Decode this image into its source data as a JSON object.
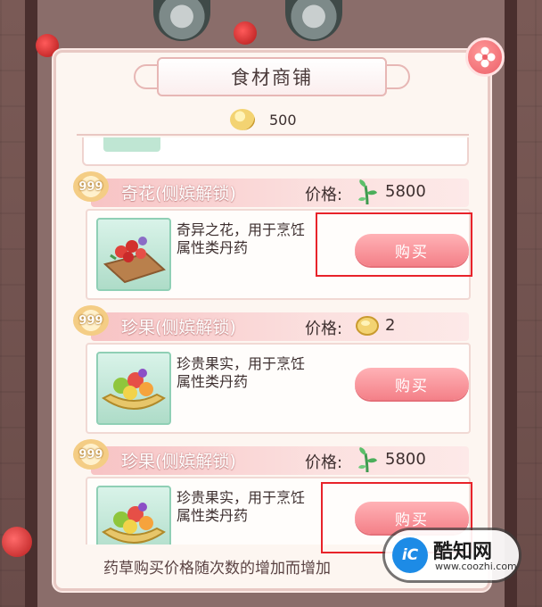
{
  "shop": {
    "title": "食材商铺",
    "coins": "500"
  },
  "items": [
    {
      "badge": "999",
      "name": "奇花(侧嫔解锁)",
      "price_label": "价格:",
      "price_icon": "herb-sprout-icon",
      "price": "5800",
      "desc_line1": "奇异之花，用于烹饪",
      "desc_line2": "属性类丹药",
      "buy_label": "购买"
    },
    {
      "badge": "999",
      "name": "珍果(侧嫔解锁)",
      "price_label": "价格:",
      "price_icon": "gold-coin-icon",
      "price": "2",
      "desc_line1": "珍贵果实，用于烹饪",
      "desc_line2": "属性类丹药",
      "buy_label": "购买"
    },
    {
      "badge": "999",
      "name": "珍果(侧嫔解锁)",
      "price_label": "价格:",
      "price_icon": "herb-sprout-icon",
      "price": "5800",
      "desc_line1": "珍贵果实，用于烹饪",
      "desc_line2": "属性类丹药",
      "buy_label": "购买"
    }
  ],
  "footer_note": "药草购买价格随次数的增加而增加",
  "watermark": {
    "logo": "iC",
    "name": "酷知网",
    "url": "www.coozhi.com"
  },
  "colors": {
    "accent": "#f48088",
    "highlight": "#e8232a",
    "panel": "#fdf6f1"
  }
}
